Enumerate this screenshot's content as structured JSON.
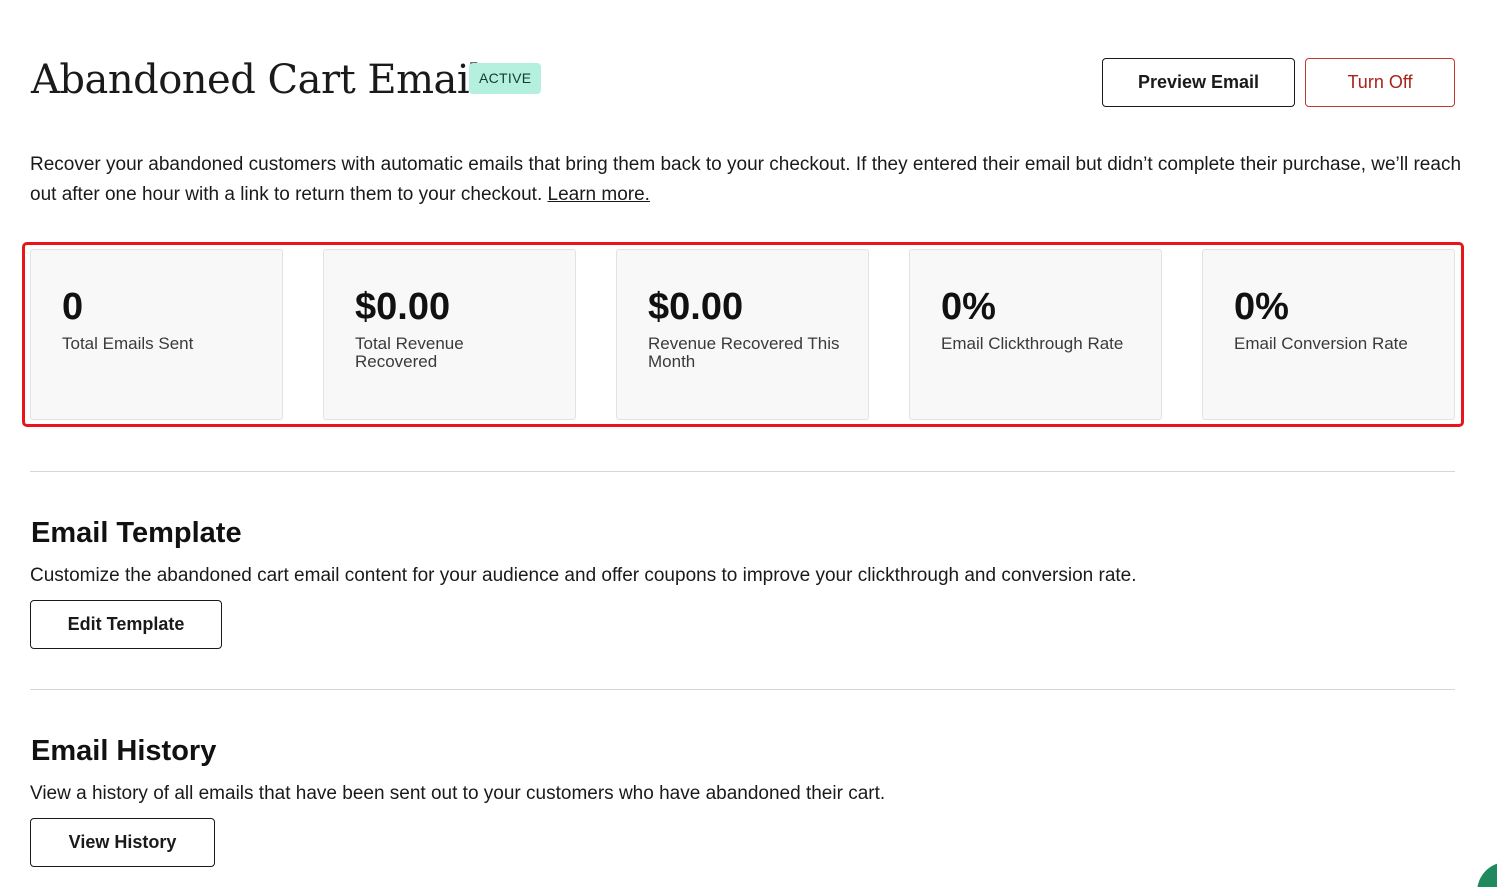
{
  "header": {
    "title": "Abandoned Cart Emails",
    "status_badge": "ACTIVE",
    "preview_button": "Preview Email",
    "turn_off_button": "Turn Off"
  },
  "intro": {
    "text": "Recover your abandoned customers with automatic emails that bring them back to your checkout. If they entered their email but didn’t complete their purchase, we’ll reach out after one hour with a link to return them to your checkout.",
    "link": "Learn more."
  },
  "stats": [
    {
      "value": "0",
      "label": "Total Emails Sent"
    },
    {
      "value": "$0.00",
      "label": "Total Revenue Recovered"
    },
    {
      "value": "$0.00",
      "label": "Revenue Recovered This Month"
    },
    {
      "value": "0%",
      "label": "Email Clickthrough Rate"
    },
    {
      "value": "0%",
      "label": "Email Conversion Rate"
    }
  ],
  "email_template": {
    "title": "Email Template",
    "description": "Customize the abandoned cart email content for your audience and offer coupons to improve your clickthrough and conversion rate.",
    "button": "Edit Template"
  },
  "email_history": {
    "title": "Email History",
    "description": "View a history of all emails that have been sent out to your customers who have abandoned their cart.",
    "button": "View History"
  },
  "colors": {
    "badge_bg": "#b5efdd",
    "turn_off": "#a8231a",
    "highlight": "#e8151a",
    "chat_launcher": "#1f8a5e"
  }
}
